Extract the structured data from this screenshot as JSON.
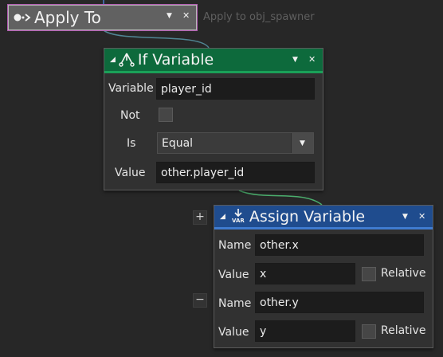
{
  "apply_to": {
    "title": "Apply To",
    "note": "Apply to obj_spawner",
    "icon": "apply-to-icon"
  },
  "if_variable": {
    "title": "If Variable",
    "icon": "branch-icon",
    "accent": "#1aa058",
    "rows": {
      "variable_label": "Variable",
      "variable_value": "player_id",
      "not_label": "Not",
      "is_label": "Is",
      "is_value": "Equal",
      "value_label": "Value",
      "value_value": "other.player_id"
    }
  },
  "assign_variable": {
    "title": "Assign Variable",
    "icon": "var-icon",
    "icon_text": "VAR",
    "accent": "#3f7bd0",
    "entries": [
      {
        "name_label": "Name",
        "name_value": "other.x",
        "value_label": "Value",
        "value_value": "x",
        "relative_label": "Relative"
      },
      {
        "name_label": "Name",
        "name_value": "other.y",
        "value_label": "Value",
        "value_value": "y",
        "relative_label": "Relative"
      }
    ],
    "add_symbol": "+",
    "remove_symbol": "−"
  },
  "header_controls": {
    "menu": "▼",
    "close": "✕",
    "collapse": "◢"
  }
}
